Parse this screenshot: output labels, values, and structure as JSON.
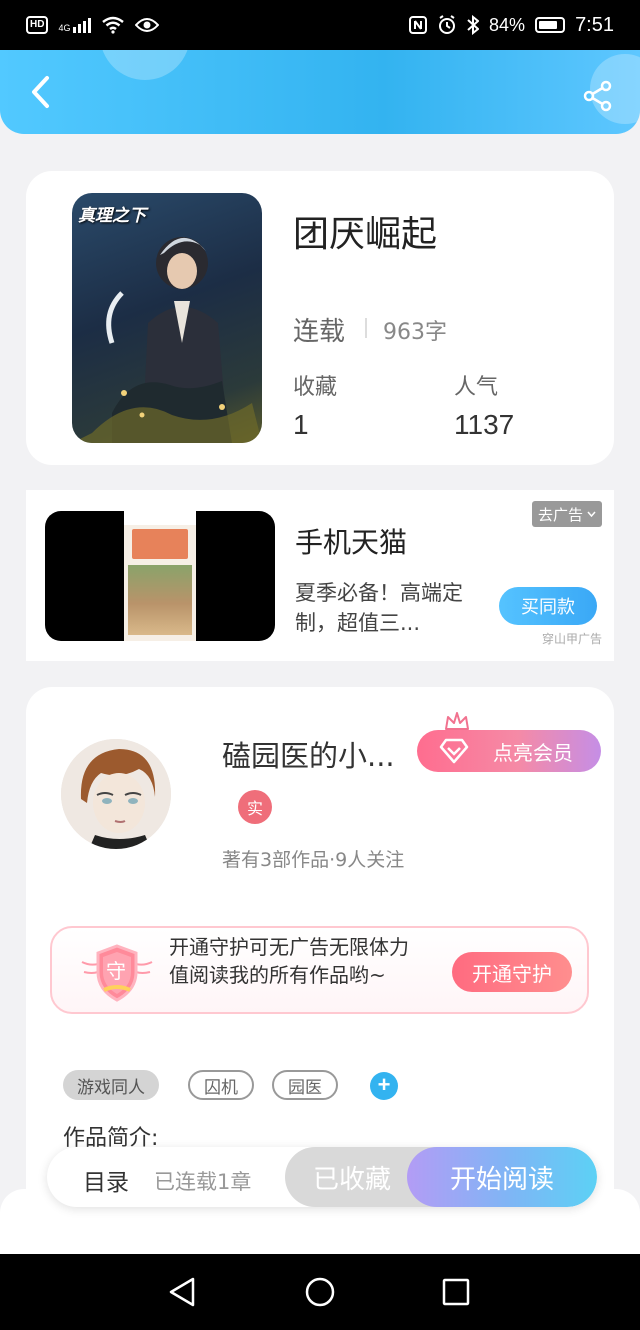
{
  "status_bar": {
    "hd": "HD",
    "network": "4G",
    "battery": "84%",
    "time": "7:51"
  },
  "header": {
    "back_icon": "chevron-left-icon",
    "share_icon": "share-icon"
  },
  "book": {
    "title": "团厌崛起",
    "cover_text": "真理之下",
    "status": "连载",
    "words": "963字",
    "favorites_label": "收藏",
    "favorites_value": "1",
    "popularity_label": "人气",
    "popularity_value": "1137"
  },
  "ad": {
    "title": "手机天猫",
    "description": "夏季必备！高端定制，超值三...",
    "close_label": "去广告",
    "buy_label": "买同款",
    "source": "穿山甲广告"
  },
  "author": {
    "name": "磕园医的小...",
    "vip_label": "点亮会员",
    "verified_label": "实",
    "meta": "著有3部作品·9人关注"
  },
  "guard": {
    "badge_text": "守",
    "text": "开通守护可无广告无限体力值阅读我的所有作品哟~",
    "button_label": "开通守护"
  },
  "tags": [
    "游戏同人",
    "囚机",
    "园医"
  ],
  "intro_label": "作品简介:",
  "action_bar": {
    "toc_label": "目录",
    "chapters_label": "已连载1章",
    "collected_label": "已收藏",
    "start_label": "开始阅读"
  },
  "colors": {
    "accent": "#33b3f0",
    "vip_pink": "#ff6d8f",
    "guard_pink": "#ff6b80"
  }
}
